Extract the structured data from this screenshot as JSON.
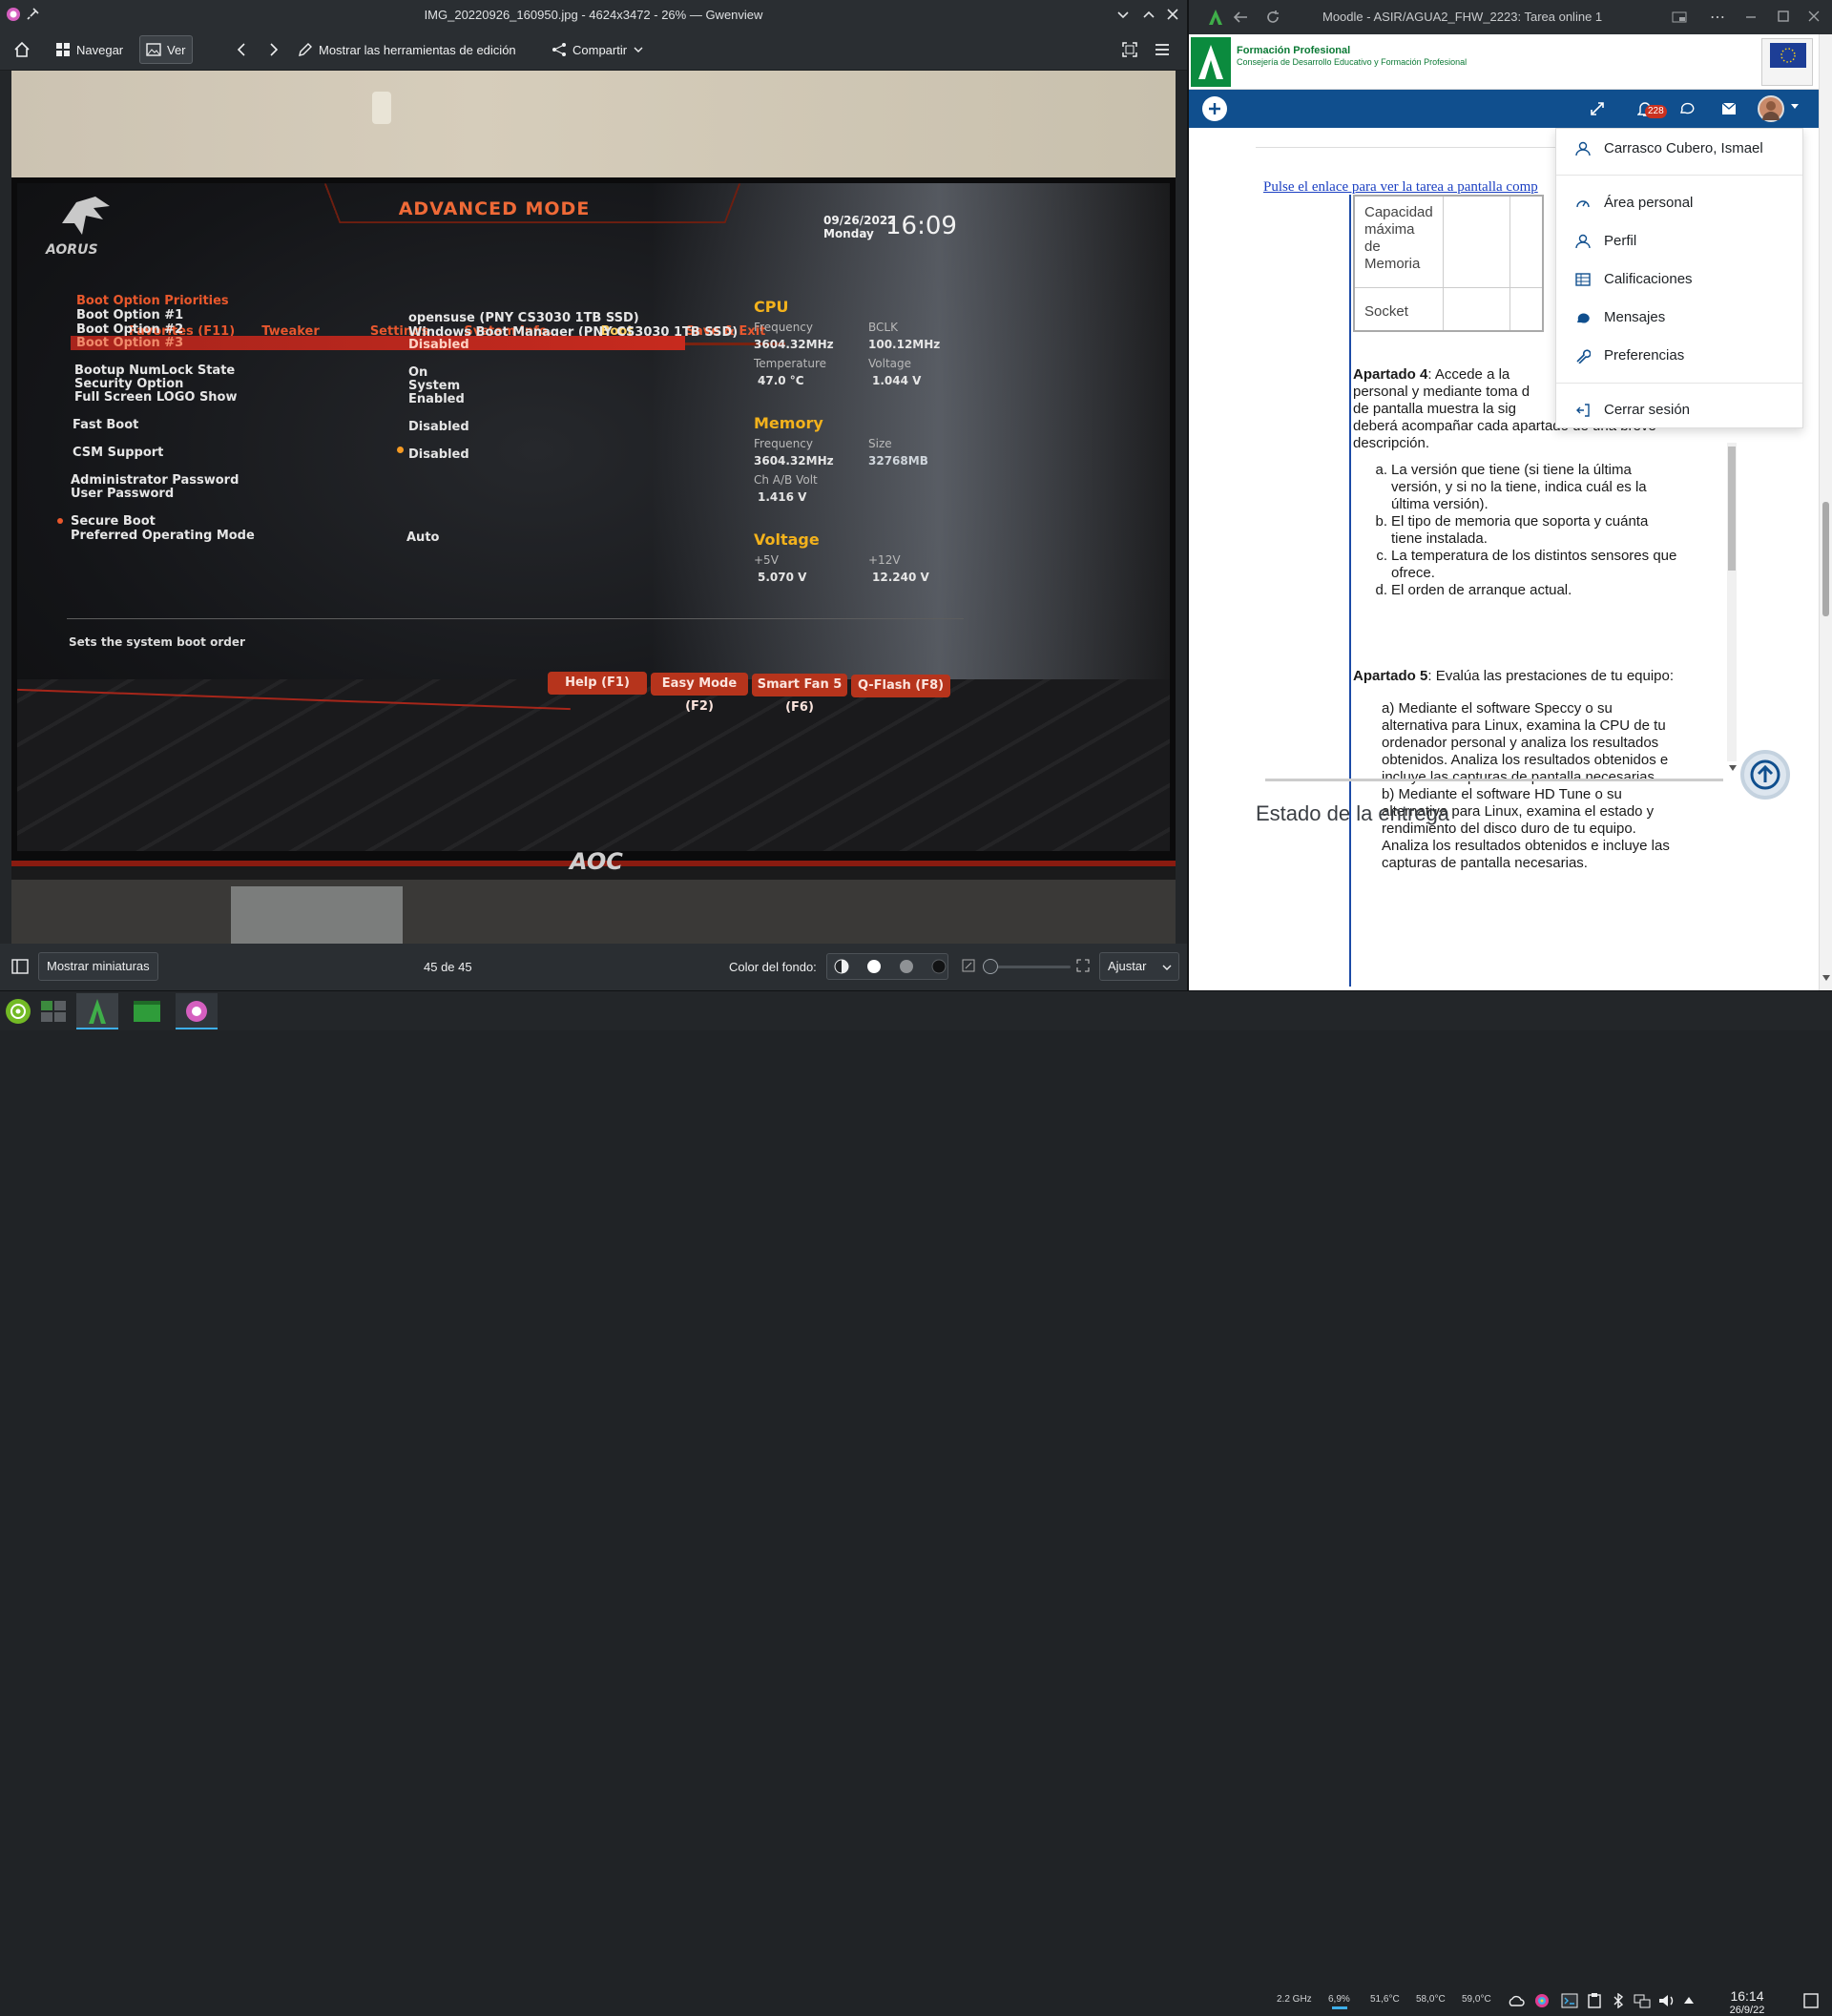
{
  "gwenview": {
    "title": "IMG_20220926_160950.jpg - 4624x3472 - 26% — Gwenview",
    "toolbar": {
      "navegar": "Navegar",
      "ver": "Ver",
      "editar": "Mostrar las herramientas de edición",
      "compartir": "Compartir"
    },
    "status": {
      "miniaturas": "Mostrar miniaturas",
      "counter": "45 de 45",
      "fondo": "Color del fondo:",
      "zoom": "Ajustar"
    }
  },
  "bios": {
    "title": "ADVANCED MODE",
    "brand": "AORUS",
    "date": "09/26/2022",
    "day": "Monday",
    "time": "16:09",
    "tabs": [
      "Favorites (F11)",
      "Tweaker",
      "Settings",
      "System Info.",
      "Boot",
      "Save & Exit"
    ],
    "rows": {
      "priorities": "Boot Option Priorities",
      "opt1": "Boot Option #1",
      "opt2": "Boot Option #2",
      "opt3": "Boot Option #3",
      "numlock": "Bootup NumLock State",
      "security": "Security Option",
      "logo": "Full Screen LOGO Show",
      "fast": "Fast Boot",
      "csm": "CSM Support",
      "admin": "Administrator Password",
      "user": "User Password",
      "secure": "Secure Boot",
      "preferred": "Preferred Operating Mode"
    },
    "values": {
      "opt1": "opensuse (PNY CS3030 1TB SSD)",
      "opt2": "Windows Boot Manager (PNY CS3030 1TB SSD)",
      "opt3": "Disabled",
      "numlock": "On",
      "security": "System",
      "logo": "Enabled",
      "fast": "Disabled",
      "csm": "Disabled",
      "preferred": "Auto"
    },
    "cpu": {
      "title": "CPU",
      "freq_label": "Frequency",
      "freq": "3604.32MHz",
      "bclk_label": "BCLK",
      "bclk": "100.12MHz",
      "temp_label": "Temperature",
      "temp": "47.0 °C",
      "volt_label": "Voltage",
      "volt": "1.044 V"
    },
    "memory": {
      "title": "Memory",
      "freq_label": "Frequency",
      "freq": "3604.32MHz",
      "size_label": "Size",
      "size": "32768MB",
      "volt_label": "Ch A/B Volt",
      "volt": "1.416 V"
    },
    "voltage": {
      "title": "Voltage",
      "p5_label": "+5V",
      "p5": "5.070 V",
      "p12_label": "+12V",
      "p12": "12.240 V"
    },
    "help_text": "Sets the system boot order",
    "fkeys": [
      "Help (F1)",
      "Easy Mode (F2)",
      "Smart Fan 5 (F6)",
      "Q-Flash (F8)"
    ],
    "monitor": "AOC"
  },
  "browser": {
    "title": "Moodle - ASIR/AGUA2_FHW_2223: Tarea online 1",
    "brand_line1": "Formación Profesional",
    "brand_line2": "Consejería de Desarrollo Educativo y Formación Profesional",
    "notif_count": "228",
    "link": "Pulse el enlace para ver la tarea a pantalla comp",
    "table": {
      "row1": [
        "Capacidad",
        "máxima",
        "de",
        "Memoria"
      ],
      "row2": "Socket"
    },
    "ap4_bold": "Apartado 4",
    "ap4_text": [
      ": Accede a la",
      "personal y mediante toma d",
      "de pantalla muestra la sig",
      "deberá acompañar cada apartado de una breve",
      "descripción."
    ],
    "ap4_list": [
      [
        "a.",
        "La versión que tiene (si tiene la última"
      ],
      [
        "",
        "versión, y si no la tiene, indica cuál es la"
      ],
      [
        "",
        "última versión)."
      ],
      [
        "b.",
        "El tipo de memoria que soporta y cuánta"
      ],
      [
        "",
        "tiene instalada."
      ],
      [
        "c.",
        "La temperatura de los distintos sensores que"
      ],
      [
        "",
        "ofrece."
      ],
      [
        "d.",
        "El orden de arranque actual."
      ]
    ],
    "ap5_bold": "Apartado 5",
    "ap5_text": ": Evalúa las prestaciones de tu equipo:",
    "ap5_a": [
      "a) Mediante el software Speccy o su",
      "alternativa para Linux, examina la CPU de tu",
      "ordenador personal y analiza los resultados",
      "obtenidos. Analiza los resultados obtenidos e",
      "incluye las capturas de pantalla necesarias."
    ],
    "ap5_b": [
      "b) Mediante el software HD Tune o su",
      "alternativa para Linux, examina el estado y",
      "rendimiento del disco duro de tu equipo.",
      "Analiza los resultados obtenidos e incluye las",
      "capturas de pantalla necesarias."
    ],
    "estado": "Estado de la entrega",
    "menu": {
      "user": "Carrasco Cubero, Ismael",
      "area": "Área personal",
      "perfil": "Perfil",
      "calif": "Calificaciones",
      "mensajes": "Mensajes",
      "pref": "Preferencias",
      "cerrar": "Cerrar sesión"
    }
  },
  "taskbar": {
    "cpu": "2.2 GHz",
    "load": "6,9%",
    "t1": "51,6°C",
    "t2": "58,0°C",
    "t3": "59,0°C",
    "time": "16:14",
    "date": "26/9/22"
  }
}
